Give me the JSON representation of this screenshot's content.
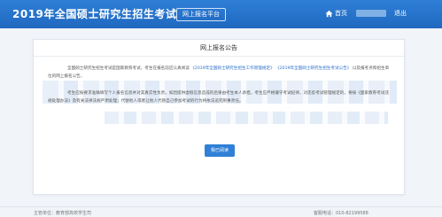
{
  "header": {
    "brand": "2019年全国硕士研究生招生考试",
    "platform_badge": "网上报名平台",
    "nav_home": "首页",
    "logout": "退出"
  },
  "notice": {
    "title": "网上报名公告",
    "paragraph1_a": "全国硕士研究生招生考试是国家教育考试，考生在报名前应认真阅读",
    "paragraph1_link1": "《2019年全国硕士研究生招生工作管理规定》",
    "paragraph1_link2": "《2019年全国硕士研究生招生考试公告》",
    "paragraph1_b": "以及报考点和招生单位的网上报名公告。",
    "paragraph2": "考生应按要求准确填写个人报名信息并对其真实性负责，如因提供虚假信息造成的后果由考生本人承担。考生应严格遵守考试纪律，对违反考试管理规定的，将按《国家教育考试违规处理办法》及有关法律法规严肃处理；代替他人或者让他人代替自己参加考试的行为将依法追究刑事责任。",
    "agree_button": "我已阅读"
  },
  "footer": {
    "left": "主管单位：教育部高校学生司",
    "right": "客服电话：010-82199588"
  },
  "colors": {
    "accent": "#2f80d6",
    "header_bg": "#1f68c0",
    "page_bg": "#f1f4f8"
  }
}
